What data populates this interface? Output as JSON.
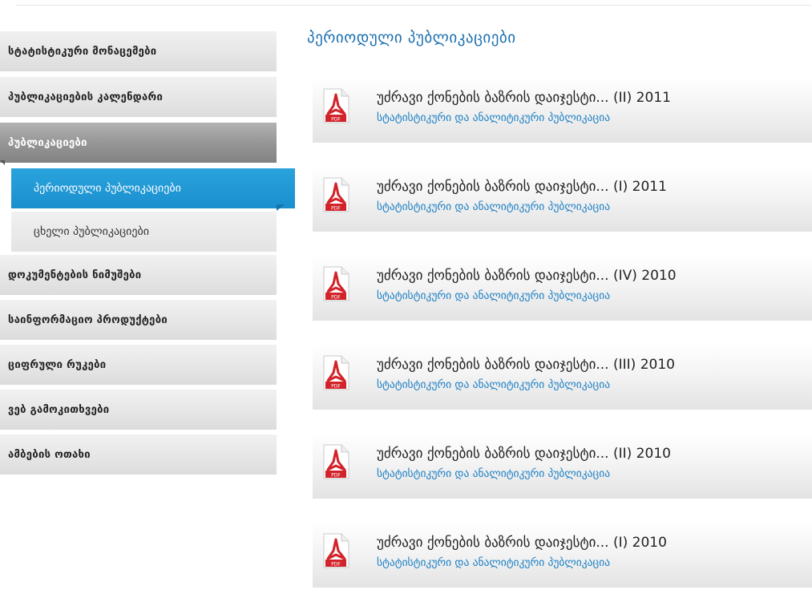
{
  "sidebar": {
    "items": [
      {
        "label": "სტატისტიკური მონაცემები"
      },
      {
        "label": "პუბლიკაციების კალენდარი"
      },
      {
        "label": "პუბლიკაციები"
      },
      {
        "label": "დოკუმენტების ნიმუშები"
      },
      {
        "label": "საინფორმაციო პროდუქტები"
      },
      {
        "label": "ციფრული რუკები"
      },
      {
        "label": "ვებ გამოკითხვები"
      },
      {
        "label": "ამბების ოთახი"
      }
    ],
    "subitems": [
      {
        "label": "პერიოდული პუბლიკაციები"
      },
      {
        "label": "ცხელი პუბლიკაციები"
      }
    ]
  },
  "main": {
    "title": "პერიოდული პუბლიკაციები",
    "publications": [
      {
        "title": "უძრავი ქონების ბაზრის დაიჯესტი... (II) 2011",
        "subtitle": "სტატისტიკური და ანალიტიკური პუბლიკაცია"
      },
      {
        "title": "უძრავი ქონების ბაზრის დაიჯესტი... (I) 2011",
        "subtitle": "სტატისტიკური და ანალიტიკური პუბლიკაცია"
      },
      {
        "title": "უძრავი ქონების ბაზრის დაიჯესტი... (IV) 2010",
        "subtitle": "სტატისტიკური და ანალიტიკური პუბლიკაცია"
      },
      {
        "title": "უძრავი ქონების ბაზრის დაიჯესტი... (III) 2010",
        "subtitle": "სტატისტიკური და ანალიტიკური პუბლიკაცია"
      },
      {
        "title": "უძრავი ქონების ბაზრის დაიჯესტი... (II) 2010",
        "subtitle": "სტატისტიკური და ანალიტიკური პუბლიკაცია"
      },
      {
        "title": "უძრავი ქონების ბაზრის დაიჯესტი... (I) 2010",
        "subtitle": "სტატისტიკური და ანალიტიკური პუბლიკაცია"
      }
    ],
    "icon": "pdf-file-icon",
    "icon_label": "PDF"
  },
  "colors": {
    "accent": "#1a8fcf",
    "title": "#1a6fb0",
    "link": "#1a7fc4",
    "pdf_red": "#d2232a"
  }
}
